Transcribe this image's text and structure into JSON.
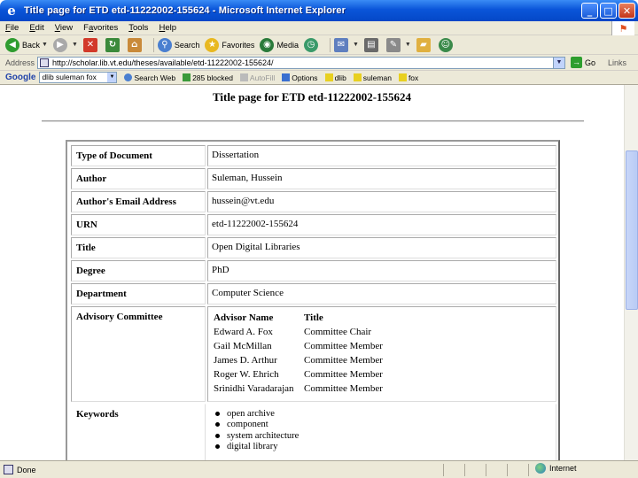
{
  "window": {
    "title": "Title page for ETD etd-11222002-155624 - Microsoft Internet Explorer",
    "minimize_glyph": "_",
    "maximize_glyph": "□",
    "close_glyph": "✕"
  },
  "menu": [
    {
      "u": "F",
      "rest": "ile"
    },
    {
      "u": "E",
      "rest": "dit"
    },
    {
      "u": "V",
      "rest": "iew"
    },
    {
      "u": "",
      "rest": "F",
      "u2": "a",
      "rest2": "vorites"
    },
    {
      "u": "T",
      "rest": "ools"
    },
    {
      "u": "H",
      "rest": "elp"
    }
  ],
  "toolbar": {
    "back": "Back",
    "search": "Search",
    "favorites": "Favorites",
    "media": "Media"
  },
  "address": {
    "label": "Address",
    "url": "http://scholar.lib.vt.edu/theses/available/etd-11222002-155624/",
    "go": "Go",
    "links": "Links"
  },
  "googlebar": {
    "logo": "Google",
    "query": "dlib suleman fox",
    "search_web": "Search Web",
    "blocked": "285 blocked",
    "autofill": "AutoFill",
    "options": "Options",
    "term1": "dlib",
    "term2": "suleman",
    "term3": "fox"
  },
  "page": {
    "title": "Title page for ETD etd-11222002-155624",
    "rows": [
      {
        "label": "Type of Document",
        "value": "Dissertation"
      },
      {
        "label": "Author",
        "value": "Suleman, Hussein"
      },
      {
        "label": "Author's Email Address",
        "value": "hussein@vt.edu"
      },
      {
        "label": "URN",
        "value": "etd-11222002-155624"
      },
      {
        "label": "Title",
        "value": "Open Digital Libraries"
      },
      {
        "label": "Degree",
        "value": "PhD"
      },
      {
        "label": "Department",
        "value": "Computer Science"
      }
    ],
    "committee": {
      "label": "Advisory Committee",
      "col_name": "Advisor Name",
      "col_title": "Title",
      "members": [
        {
          "name": "Edward A. Fox",
          "title": "Committee Chair"
        },
        {
          "name": "Gail McMillan",
          "title": "Committee Member"
        },
        {
          "name": "James D. Arthur",
          "title": "Committee Member"
        },
        {
          "name": "Roger W. Ehrich",
          "title": "Committee Member"
        },
        {
          "name": "Srinidhi Varadarajan",
          "title": "Committee Member"
        }
      ]
    },
    "keywords": {
      "label": "Keywords",
      "items": [
        "open archive",
        "component",
        "system architecture",
        "digital library"
      ]
    }
  },
  "status": {
    "text": "Done",
    "zone": "Internet"
  }
}
